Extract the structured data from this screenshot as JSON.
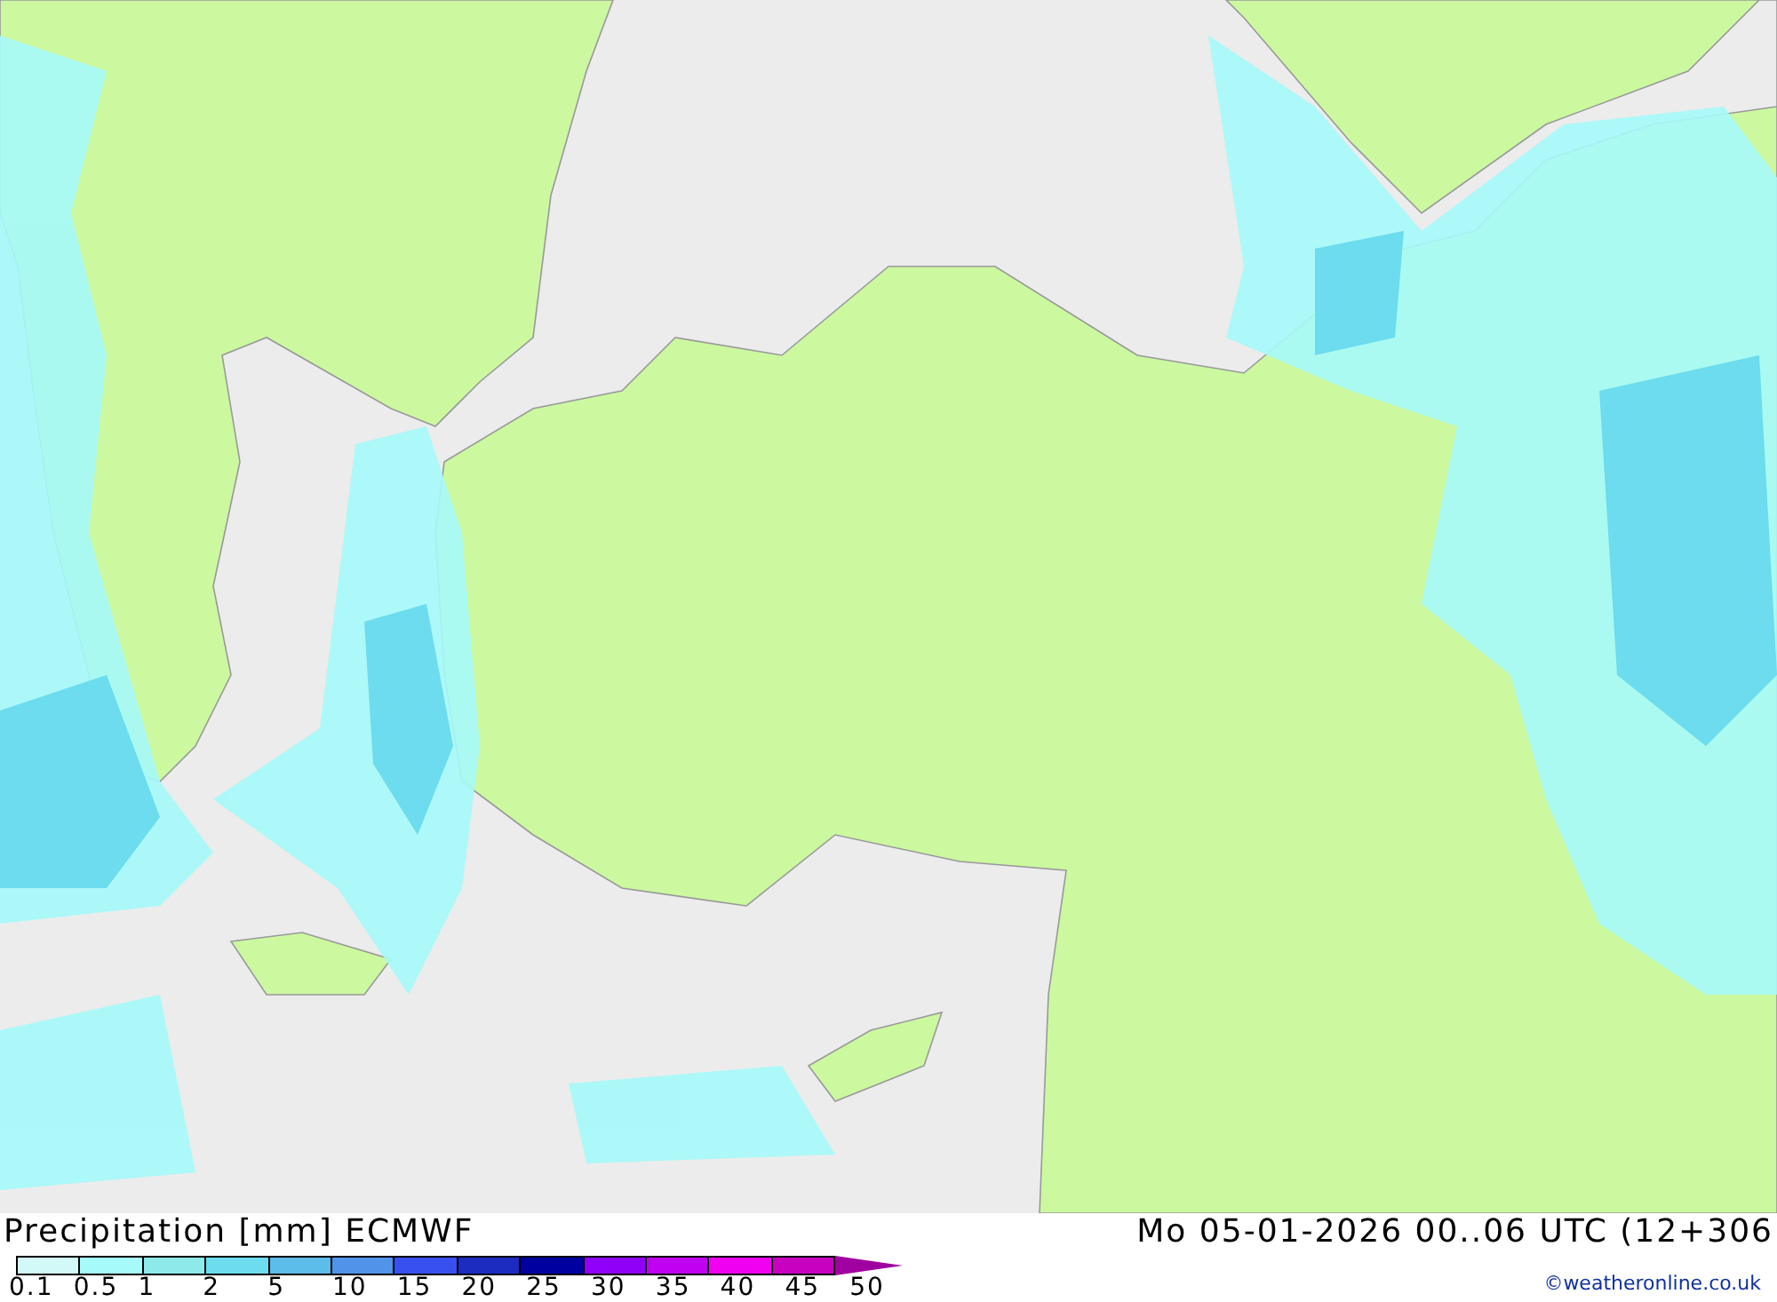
{
  "map": {
    "kind": "precipitation"
  },
  "legend": {
    "title": "Precipitation [mm] ECMWF",
    "swatches": [
      {
        "color": "#d2f8f8"
      },
      {
        "color": "#a6fafa"
      },
      {
        "color": "#8eeaea"
      },
      {
        "color": "#6cdcee"
      },
      {
        "color": "#5cbcea"
      },
      {
        "color": "#5094ea"
      },
      {
        "color": "#3850f0"
      },
      {
        "color": "#1c2cc0"
      },
      {
        "color": "#0000a0"
      },
      {
        "color": "#9000f8"
      },
      {
        "color": "#c000f0"
      },
      {
        "color": "#f000f0"
      },
      {
        "color": "#c800c0"
      }
    ],
    "ticks": [
      "0.1",
      "0.5",
      "1",
      "2",
      "5",
      "10",
      "15",
      "20",
      "25",
      "30",
      "35",
      "40",
      "45",
      "50"
    ]
  },
  "valid_time": "Mo 05-01-2026 00..06 UTC (12+306",
  "credit": "©weatheronline.co.uk"
}
